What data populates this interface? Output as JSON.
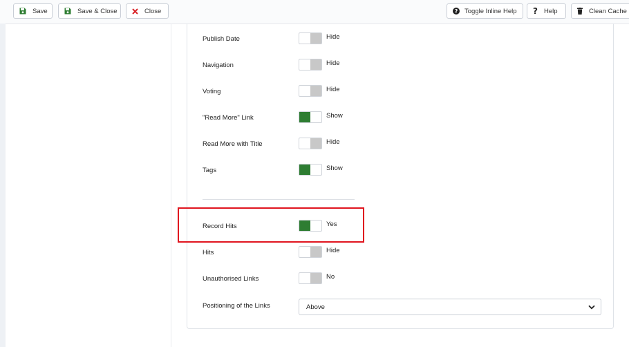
{
  "toolbar": {
    "save_label": "Save",
    "save_close_label": "Save & Close",
    "close_label": "Close",
    "toggle_help_label": "Toggle Inline Help",
    "help_label": "Help",
    "clean_cache_label": "Clean Cache"
  },
  "options": [
    {
      "label": "Publish Date",
      "state": "Hide",
      "on": false
    },
    {
      "label": "Navigation",
      "state": "Hide",
      "on": false
    },
    {
      "label": "Voting",
      "state": "Hide",
      "on": false
    },
    {
      "label": "\"Read More\" Link",
      "state": "Show",
      "on": true
    },
    {
      "label": "Read More with Title",
      "state": "Hide",
      "on": false
    },
    {
      "label": "Tags",
      "state": "Show",
      "on": true
    },
    {
      "label": "Record Hits",
      "state": "Yes",
      "on": true
    },
    {
      "label": "Hits",
      "state": "Hide",
      "on": false
    },
    {
      "label": "Unauthorised Links",
      "state": "No",
      "on": false
    }
  ],
  "positioning": {
    "label": "Positioning of the Links",
    "value": "Above"
  },
  "colors": {
    "toggle_on": "#2e7d32",
    "toggle_off": "#c8c8c8",
    "highlight": "#e0141e",
    "close_icon": "#d9262b"
  },
  "icons": {
    "save": "floppy-disk-icon",
    "close": "x-icon",
    "help_toggle": "question-circle-icon",
    "help": "question-mark-icon",
    "cache": "trash-icon",
    "dropdown": "chevron-down-icon"
  }
}
